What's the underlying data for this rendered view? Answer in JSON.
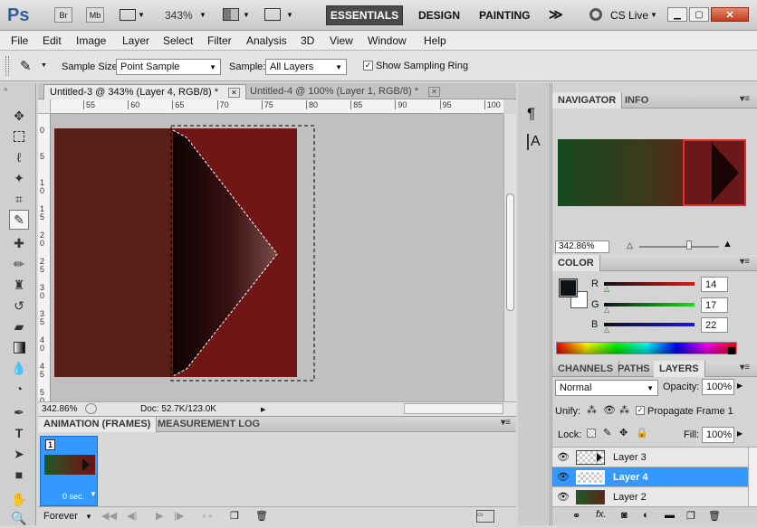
{
  "app": {
    "logo": "Ps",
    "bridge": "Br",
    "minibridge": "Mb",
    "zoom": "343%",
    "workspaces": [
      "ESSENTIALS",
      "DESIGN",
      "PAINTING"
    ],
    "more": "≫",
    "cslive": "CS Live",
    "colors": {
      "accent": "#3399ff",
      "chrome": "#d6d6d6",
      "essentials_bg": "#4a4a4a"
    }
  },
  "menu": [
    "File",
    "Edit",
    "Image",
    "Layer",
    "Select",
    "Filter",
    "Analysis",
    "3D",
    "View",
    "Window",
    "Help"
  ],
  "options": {
    "sample_size_label": "Sample Size:",
    "sample_size_value": "Point Sample",
    "sample_label": "Sample:",
    "sample_value": "All Layers",
    "show_ring_label": "Show Sampling Ring"
  },
  "tabs": [
    {
      "label": "Untitled-3 @ 343% (Layer 4, RGB/8) *",
      "close": "✕"
    },
    {
      "label": "Untitled-4 @ 100% (Layer 1, RGB/8) *",
      "close": "✕"
    }
  ],
  "ruler_top": [
    "55",
    "60",
    "65",
    "70",
    "75",
    "80",
    "85",
    "90",
    "95",
    "100"
  ],
  "ruler_left": [
    "0",
    "5",
    "1 0",
    "1 5",
    "2 0",
    "2 5",
    "3 0",
    "3 5",
    "4 0",
    "4 5",
    "5 0"
  ],
  "status": {
    "zoom": "342.86%",
    "doc": "Doc: 52.7K/123.0K"
  },
  "animation": {
    "tab1": "ANIMATION (FRAMES)",
    "tab2": "MEASUREMENT LOG",
    "frame_number": "1",
    "frame_delay": "0 sec.",
    "loop": "Forever"
  },
  "navigator": {
    "tab1": "NAVIGATOR",
    "tab2": "INFO",
    "zoom": "342.86%"
  },
  "color": {
    "title": "COLOR",
    "r_label": "R",
    "g_label": "G",
    "b_label": "B",
    "r": "14",
    "g": "17",
    "b": "22"
  },
  "layers": {
    "tabs": [
      "CHANNELS",
      "PATHS",
      "LAYERS"
    ],
    "blend": "Normal",
    "opacity_label": "Opacity:",
    "opacity": "100%",
    "unify_label": "Unify:",
    "propagate_label": "Propagate Frame 1",
    "lock_label": "Lock:",
    "fill_label": "Fill:",
    "fill": "100%",
    "items": [
      {
        "name": "Layer 3",
        "selected": false
      },
      {
        "name": "Layer 4",
        "selected": true
      },
      {
        "name": "Layer 2",
        "selected": false
      }
    ]
  }
}
